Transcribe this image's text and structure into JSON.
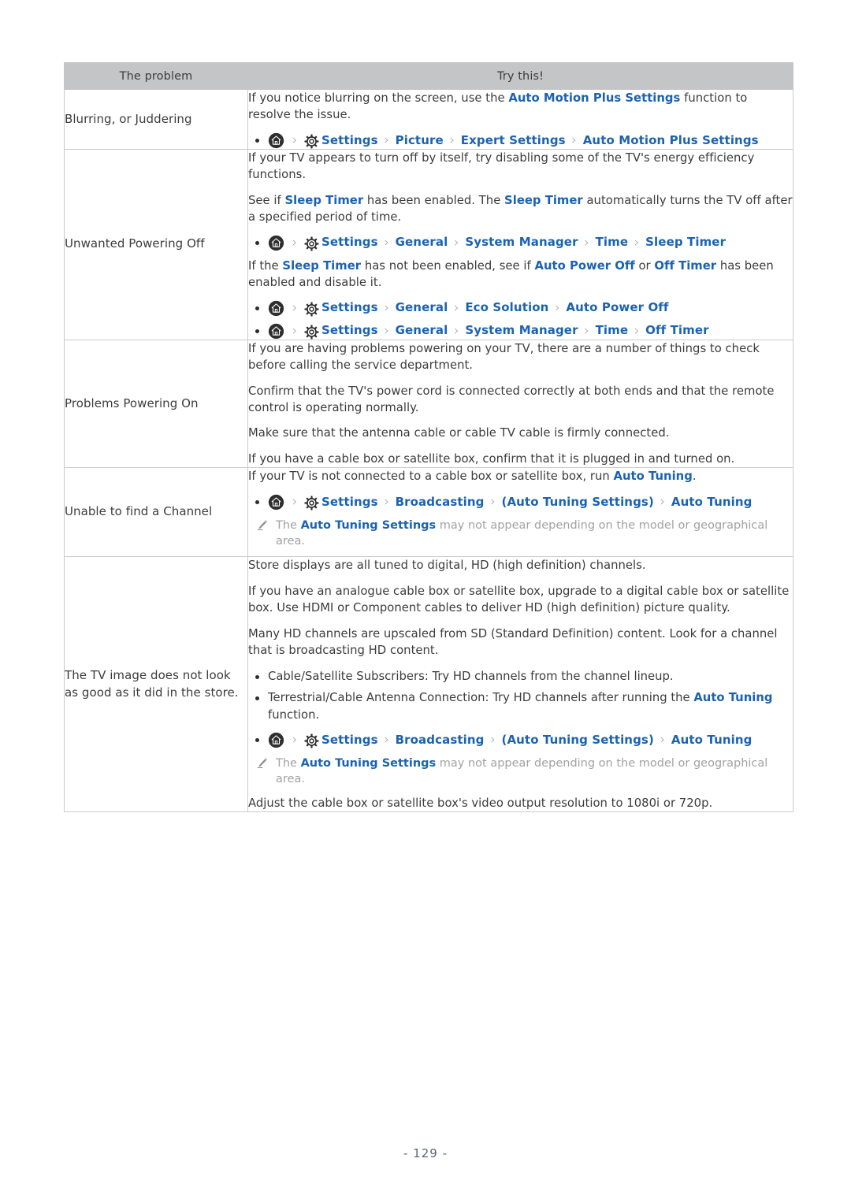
{
  "page": {
    "number_label": "- 129 -"
  },
  "table": {
    "headers": [
      "The problem",
      "Try this!"
    ],
    "icons": {
      "home": "home-icon",
      "gear": "gear-icon",
      "chevron": "chevron-right-icon",
      "pencil": "pencil-note-icon"
    },
    "chevron_glyph": "›",
    "colors": {
      "link": "#1b63b0",
      "header_bg": "#c3c5c6",
      "text": "#3c3c3c",
      "note": "#a2a2a2",
      "border": "#c9cbcc"
    },
    "rows": [
      {
        "problem": "Blurring, or Juddering",
        "blocks": [
          {
            "type": "para",
            "runs": [
              {
                "t": "If you notice blurring on the screen, use the "
              },
              {
                "t": "Auto Motion Plus Settings",
                "link": true
              },
              {
                "t": " function to resolve the issue."
              }
            ]
          },
          {
            "type": "path",
            "items": [
              "Settings",
              "Picture",
              "Expert Settings",
              "Auto Motion Plus Settings"
            ]
          }
        ]
      },
      {
        "problem": "Unwanted Powering Off",
        "blocks": [
          {
            "type": "para",
            "runs": [
              {
                "t": "If your TV appears to turn off by itself, try disabling some of the TV's energy efficiency functions."
              }
            ]
          },
          {
            "type": "para",
            "runs": [
              {
                "t": "See if "
              },
              {
                "t": "Sleep Timer",
                "link": true
              },
              {
                "t": " has been enabled. The "
              },
              {
                "t": "Sleep Timer",
                "link": true
              },
              {
                "t": " automatically turns the TV off after a specified period of time."
              }
            ]
          },
          {
            "type": "path",
            "items": [
              "Settings",
              "General",
              "System Manager",
              "Time",
              "Sleep Timer"
            ]
          },
          {
            "type": "para",
            "runs": [
              {
                "t": "If the "
              },
              {
                "t": "Sleep Timer",
                "link": true
              },
              {
                "t": " has not been enabled, see if "
              },
              {
                "t": "Auto Power Off",
                "link": true
              },
              {
                "t": " or "
              },
              {
                "t": "Off Timer",
                "link": true
              },
              {
                "t": " has been enabled and disable it."
              }
            ]
          },
          {
            "type": "path",
            "items": [
              "Settings",
              "General",
              "Eco Solution",
              "Auto Power Off"
            ]
          },
          {
            "type": "path",
            "items": [
              "Settings",
              "General",
              "System Manager",
              "Time",
              "Off Timer"
            ]
          }
        ]
      },
      {
        "problem": "Problems Powering On",
        "blocks": [
          {
            "type": "para",
            "runs": [
              {
                "t": "If you are having problems powering on your TV, there are a number of things to check before calling the service department."
              }
            ]
          },
          {
            "type": "para",
            "runs": [
              {
                "t": "Confirm that the TV's power cord is connected correctly at both ends and that the remote control is operating normally."
              }
            ]
          },
          {
            "type": "para",
            "runs": [
              {
                "t": "Make sure that the antenna cable or cable TV cable is firmly connected."
              }
            ]
          },
          {
            "type": "para",
            "runs": [
              {
                "t": "If you have a cable box or satellite box, confirm that it is plugged in and turned on."
              }
            ]
          }
        ]
      },
      {
        "problem": "Unable to find a Channel",
        "blocks": [
          {
            "type": "para",
            "runs": [
              {
                "t": "If your TV is not connected to a cable box or satellite box, run "
              },
              {
                "t": "Auto Tuning",
                "link": true
              },
              {
                "t": "."
              }
            ]
          },
          {
            "type": "path",
            "items": [
              "Settings",
              "Broadcasting",
              "(Auto Tuning Settings)",
              "Auto Tuning"
            ]
          },
          {
            "type": "note",
            "runs": [
              {
                "t": "The "
              },
              {
                "t": "Auto Tuning Settings",
                "link": true
              },
              {
                "t": " may not appear depending on the model or geographical area."
              }
            ]
          }
        ]
      },
      {
        "problem": "The TV image does not look as good as it did in the store.",
        "blocks": [
          {
            "type": "para",
            "runs": [
              {
                "t": "Store displays are all tuned to digital, HD (high definition) channels."
              }
            ]
          },
          {
            "type": "para",
            "runs": [
              {
                "t": "If you have an analogue cable box or satellite box, upgrade to a digital cable box or satellite box. Use HDMI or Component cables to deliver HD (high definition) picture quality."
              }
            ]
          },
          {
            "type": "para",
            "runs": [
              {
                "t": "Many HD channels are upscaled from SD (Standard Definition) content. Look for a channel that is broadcasting HD content."
              }
            ]
          },
          {
            "type": "list",
            "items": [
              [
                {
                  "t": "Cable/Satellite Subscribers: Try HD channels from the channel lineup."
                }
              ],
              [
                {
                  "t": "Terrestrial/Cable Antenna Connection: Try HD channels after running the "
                },
                {
                  "t": "Auto Tuning",
                  "link": true
                },
                {
                  "t": " function."
                }
              ]
            ]
          },
          {
            "type": "path",
            "items": [
              "Settings",
              "Broadcasting",
              "(Auto Tuning Settings)",
              "Auto Tuning"
            ]
          },
          {
            "type": "note",
            "runs": [
              {
                "t": "The "
              },
              {
                "t": "Auto Tuning Settings",
                "link": true
              },
              {
                "t": " may not appear depending on the model or geographical area."
              }
            ]
          },
          {
            "type": "para",
            "runs": [
              {
                "t": "Adjust the cable box or satellite box's video output resolution to 1080i or 720p."
              }
            ]
          }
        ]
      }
    ]
  }
}
